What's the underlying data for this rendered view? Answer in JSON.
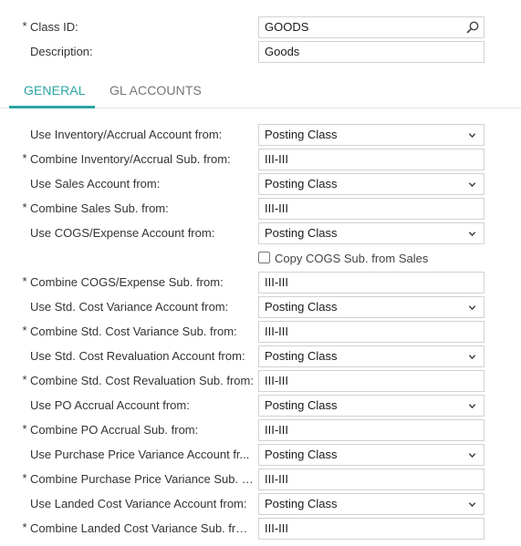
{
  "header": {
    "class_id": {
      "label": "Class ID:",
      "value": "GOODS",
      "required": "*"
    },
    "description": {
      "label": "Description:",
      "value": "Goods"
    }
  },
  "tabs": [
    {
      "label": "GENERAL",
      "active": true
    },
    {
      "label": "GL ACCOUNTS",
      "active": false
    }
  ],
  "rows": [
    {
      "label": "Use Inventory/Accrual Account from:",
      "value": "Posting Class",
      "type": "select",
      "required": ""
    },
    {
      "label": "Combine Inventory/Accrual Sub. from:",
      "value": "III-III",
      "type": "text",
      "required": "*"
    },
    {
      "label": "Use Sales Account from:",
      "value": "Posting Class",
      "type": "select",
      "required": ""
    },
    {
      "label": "Combine Sales Sub. from:",
      "value": "III-III",
      "type": "text",
      "required": "*"
    },
    {
      "label": "Use COGS/Expense Account from:",
      "value": "Posting Class",
      "type": "select",
      "required": ""
    },
    {
      "label": "Combine COGS/Expense Sub. from:",
      "value": "III-III",
      "type": "text",
      "required": "*"
    },
    {
      "label": "Use Std. Cost Variance Account from:",
      "value": "Posting Class",
      "type": "select",
      "required": ""
    },
    {
      "label": "Combine Std. Cost Variance Sub. from:",
      "value": "III-III",
      "type": "text",
      "required": "*"
    },
    {
      "label": "Use Std. Cost Revaluation Account from:",
      "value": "Posting Class",
      "type": "select",
      "required": ""
    },
    {
      "label": "Combine Std. Cost Revaluation Sub. from:",
      "value": "III-III",
      "type": "text",
      "required": "*"
    },
    {
      "label": "Use PO Accrual Account from:",
      "value": "Posting Class",
      "type": "select",
      "required": ""
    },
    {
      "label": "Combine PO Accrual Sub. from:",
      "value": "III-III",
      "type": "text",
      "required": "*"
    },
    {
      "label": "Use Purchase Price Variance Account fr...",
      "value": "Posting Class",
      "type": "select",
      "required": ""
    },
    {
      "label": "Combine Purchase Price Variance Sub. f...",
      "value": "III-III",
      "type": "text",
      "required": "*"
    },
    {
      "label": "Use Landed Cost Variance Account from:",
      "value": "Posting Class",
      "type": "select",
      "required": ""
    },
    {
      "label": "Combine Landed Cost Variance Sub. from:",
      "value": "III-III",
      "type": "text",
      "required": "*"
    }
  ],
  "copy_cogs": {
    "label": "Copy COGS Sub. from Sales",
    "checked": false
  },
  "icons": {
    "search": "search-icon",
    "dropdown": "chevron-down-icon"
  }
}
